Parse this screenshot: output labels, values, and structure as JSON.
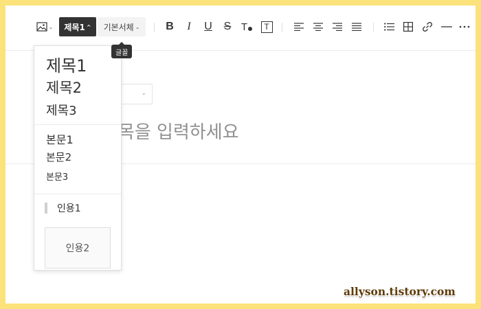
{
  "toolbar": {
    "image_icon": "image-icon",
    "heading_label": "제목1",
    "font_label": "기본서체",
    "font_tooltip": "글꼴",
    "bold_label": "B",
    "italic_label": "I",
    "underline_label": "U",
    "strike_label": "S",
    "text_color_label": "T",
    "text_bg_label": "T"
  },
  "editor": {
    "title_placeholder": "제목을 입력하세요",
    "category_value": ""
  },
  "heading_menu": {
    "heading1": "제목1",
    "heading2": "제목2",
    "heading3": "제목3",
    "body1": "본문1",
    "body2": "본문2",
    "body3": "본문3",
    "quote1": "인용1",
    "quote2": "인용2"
  },
  "watermark": "allyson.tistory.com",
  "colors": {
    "frame": "#fbe27a",
    "active_button": "#333333",
    "tooltip_bg": "#333333"
  }
}
